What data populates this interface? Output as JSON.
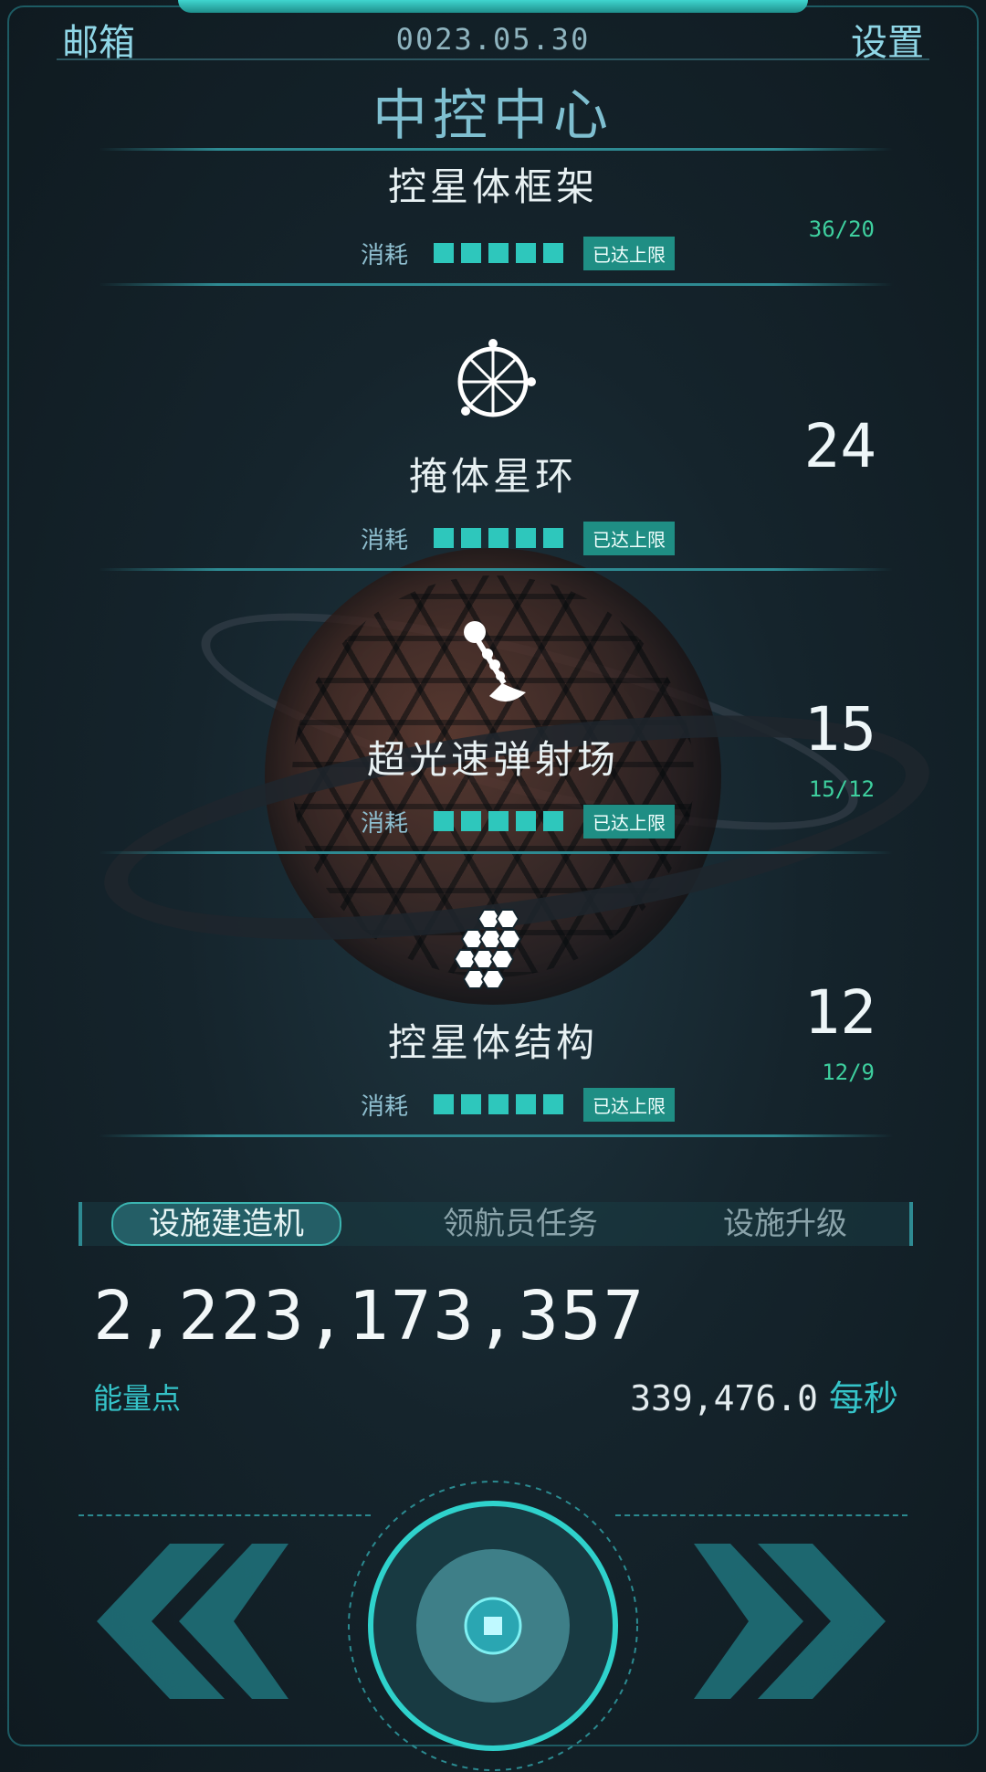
{
  "header": {
    "mail_label": "邮箱",
    "date": "0023.05.30",
    "settings_label": "设置",
    "title": "中控中心"
  },
  "items": [
    {
      "name": "控星体框架",
      "count": "",
      "ratio": "36/20",
      "cost_label": "消耗",
      "badge": "已达上限",
      "icon": "frame-icon"
    },
    {
      "name": "掩体星环",
      "count": "24",
      "ratio": "",
      "cost_label": "消耗",
      "badge": "已达上限",
      "icon": "star-ring-icon"
    },
    {
      "name": "超光速弹射场",
      "count": "15",
      "ratio": "15/12",
      "cost_label": "消耗",
      "badge": "已达上限",
      "icon": "launcher-icon"
    },
    {
      "name": "控星体结构",
      "count": "12",
      "ratio": "12/9",
      "cost_label": "消耗",
      "badge": "已达上限",
      "icon": "hexagon-structure-icon"
    }
  ],
  "tabs": [
    "设施建造机",
    "领航员任务",
    "设施升级"
  ],
  "active_tab": 0,
  "energy": {
    "value": "2,223,173,357",
    "label": "能量点",
    "rate": "339,476.0",
    "rate_unit": "每秒"
  },
  "colors": {
    "accent": "#2ec7bc",
    "badge": "#1f8e84",
    "ratio_text": "#3ecf9e",
    "background": "#15242c"
  },
  "icons": {
    "prev": "double-chevron-left-icon",
    "next": "double-chevron-right-icon",
    "core": "core-button-icon"
  }
}
